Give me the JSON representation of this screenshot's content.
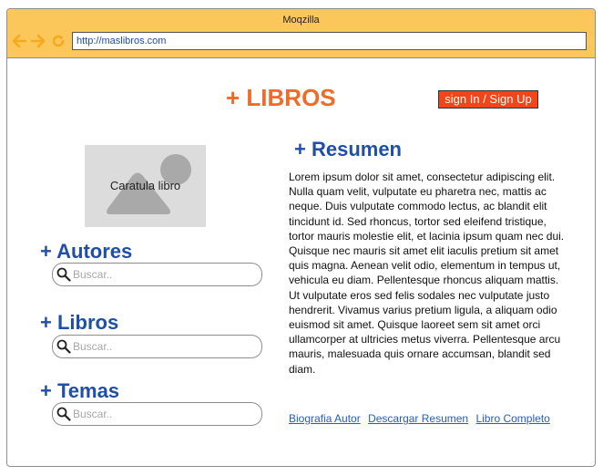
{
  "window": {
    "title": "Moqzilla",
    "url": "http://maslibros.com"
  },
  "header": {
    "site_title": "+ LIBROS",
    "signin_label": "sign In / Sign Up"
  },
  "cover": {
    "label": "Caratula libro"
  },
  "sections": {
    "autores": {
      "heading": "+ Autores",
      "search_placeholder": "Buscar.."
    },
    "libros": {
      "heading": "+ Libros",
      "search_placeholder": "Buscar.."
    },
    "temas": {
      "heading": "+ Temas",
      "search_placeholder": "Buscar.."
    }
  },
  "summary": {
    "heading": "+ Resumen",
    "text": "Lorem ipsum dolor sit amet, consectetur adipiscing elit. Nulla quam velit, vulputate eu pharetra nec, mattis ac neque. Duis vulputate commodo lectus, ac blandit elit tincidunt id. Sed rhoncus, tortor sed eleifend tristique, tortor mauris molestie elit, et lacinia ipsum quam nec dui. Quisque nec mauris sit amet elit iaculis pretium sit amet quis magna. Aenean velit odio, elementum in tempus ut, vehicula eu diam. Pellentesque rhoncus aliquam mattis. Ut vulputate eros sed felis sodales nec vulputate justo hendrerit. Vivamus varius pretium ligula, a aliquam odio euismod sit amet. Quisque laoreet sem sit amet orci ullamcorper at ultricies metus viverra. Pellentesque arcu mauris, malesuada quis ornare accumsan, blandit sed diam."
  },
  "links": {
    "biografia": "Biografia Autor",
    "descargar": "Descargar Resumen",
    "libro": "Libro Completo"
  },
  "icons": {
    "back": "arrow-left-icon",
    "forward": "arrow-right-icon",
    "reload": "reload-icon",
    "search": "search-icon",
    "image_placeholder": "image-placeholder-icon"
  },
  "colors": {
    "titlebar": "#fcc75a",
    "accent_orange": "#f26a2a",
    "signin_bg": "#f2461a",
    "heading_blue": "#1f4fa8",
    "link_blue": "#1f5fc8"
  }
}
